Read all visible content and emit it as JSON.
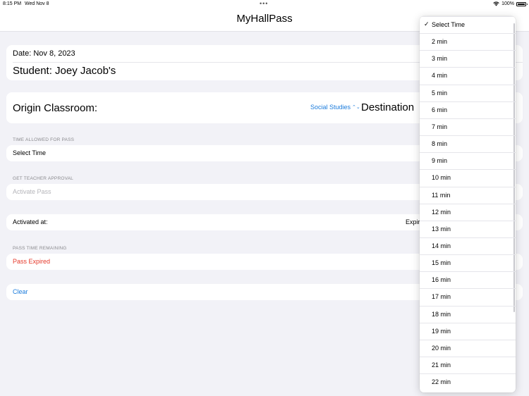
{
  "status_bar": {
    "time": "8:15 PM",
    "date": "Wed Nov 8",
    "battery_percent": "100%",
    "battery_level": 1.0
  },
  "nav": {
    "title": "MyHallPass"
  },
  "pass_info": {
    "date_label": "Date: Nov 8, 2023",
    "student_label": "Student: Joey Jacob's"
  },
  "origin": {
    "label": "Origin Classroom:",
    "selected": "Social Studies",
    "destination_label": "Destination"
  },
  "time_allowed": {
    "header": "TIME ALLOWED FOR PASS",
    "value": "Select Time"
  },
  "teacher_approval": {
    "header": "GET TEACHER APPROVAL",
    "action": "Activate Pass"
  },
  "activation": {
    "label": "Activated at:",
    "right_label": "Expir"
  },
  "remaining": {
    "header": "PASS TIME REMAINING",
    "status": "Pass Expired"
  },
  "actions": {
    "clear": "Clear"
  },
  "time_menu": {
    "check_glyph": "✓",
    "options": [
      "Select Time",
      "2 min",
      "3 min",
      "4 min",
      "5 min",
      "6 min",
      "7 min",
      "8 min",
      "9 min",
      "10 min",
      "11 min",
      "12 min",
      "13 min",
      "14 min",
      "15 min",
      "16 min",
      "17 min",
      "18 min",
      "19 min",
      "20 min",
      "21 min",
      "22 min"
    ],
    "selected_index": 0
  },
  "colors": {
    "accent": "#1a7bdc",
    "expired": "#e5392b",
    "background": "#f2f2f7"
  },
  "icons": [
    "wifi-icon",
    "battery-icon",
    "chevron-updown-icon",
    "checkmark-icon"
  ]
}
